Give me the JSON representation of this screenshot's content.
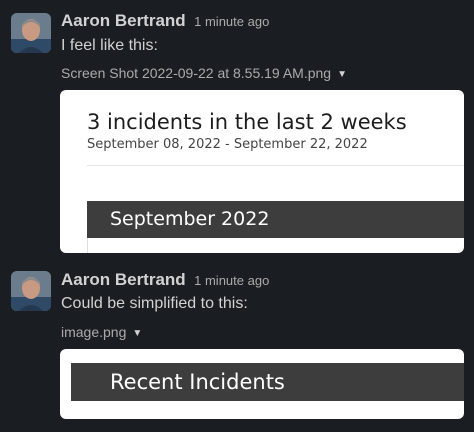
{
  "messages": [
    {
      "author": "Aaron Bertrand",
      "time": "1 minute ago",
      "text": "I feel like this:",
      "attachment": {
        "file_name": "Screen Shot 2022-09-22 at 8.55.19 AM.png",
        "caret_icon": "chevron-down-icon",
        "preview": {
          "title": "3 incidents in the last 2 weeks",
          "date_range": "September 08, 2022 - September 22, 2022",
          "month_header": "September 2022"
        }
      }
    },
    {
      "author": "Aaron Bertrand",
      "time": "1 minute ago",
      "text": "Could be simplified to this:",
      "attachment": {
        "file_name": "image.png",
        "caret_icon": "chevron-down-icon",
        "preview": {
          "header": "Recent Incidents"
        }
      }
    }
  ],
  "colors": {
    "background": "#1a1d21",
    "text": "#d1d2d3",
    "muted": "#ababad",
    "preview_bar": "#3e3d3d",
    "preview_card": "#ffffff"
  }
}
